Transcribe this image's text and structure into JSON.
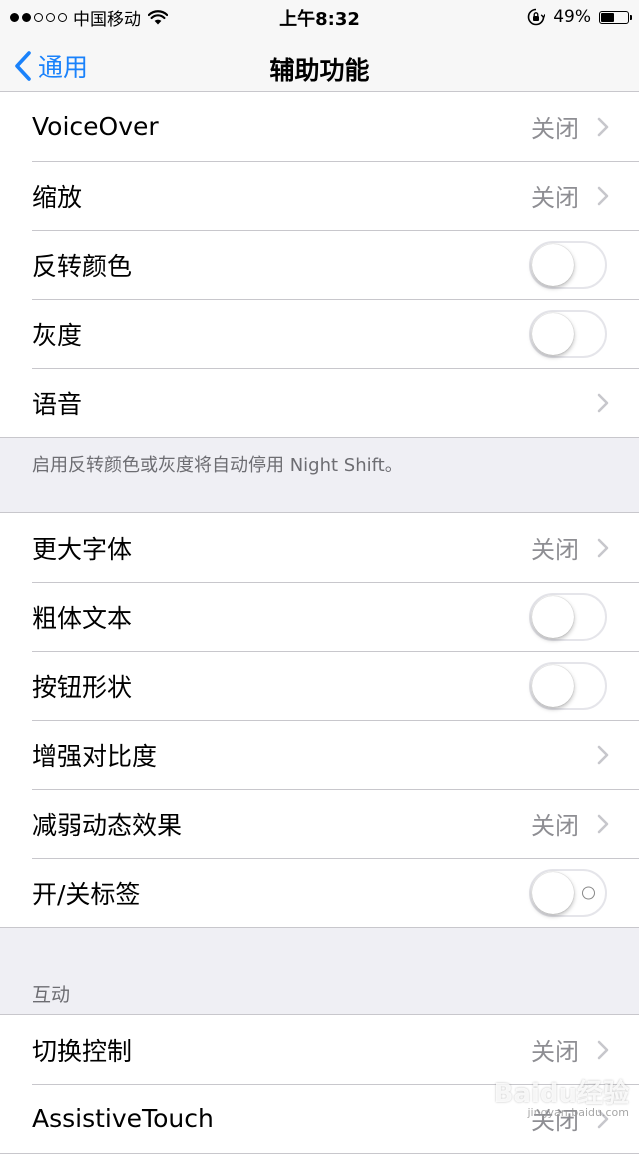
{
  "status_bar": {
    "signal_dots": [
      true,
      true,
      false,
      false,
      false
    ],
    "carrier": "中国移动",
    "time": "上午8:32",
    "battery_percent_text": "49%",
    "battery_level": 0.49
  },
  "nav": {
    "back_label": "通用",
    "title": "辅助功能"
  },
  "group1": {
    "rows": [
      {
        "label": "VoiceOver",
        "value": "关闭",
        "type": "link"
      },
      {
        "label": "缩放",
        "value": "关闭",
        "type": "link"
      },
      {
        "label": "反转颜色",
        "type": "toggle",
        "on": false
      },
      {
        "label": "灰度",
        "type": "toggle",
        "on": false
      },
      {
        "label": "语音",
        "type": "link"
      }
    ],
    "footer": "启用反转颜色或灰度将自动停用 Night Shift。"
  },
  "group2": {
    "rows": [
      {
        "label": "更大字体",
        "value": "关闭",
        "type": "link"
      },
      {
        "label": "粗体文本",
        "type": "toggle",
        "on": false
      },
      {
        "label": "按钮形状",
        "type": "toggle",
        "on": false
      },
      {
        "label": "增强对比度",
        "type": "link"
      },
      {
        "label": "减弱动态效果",
        "value": "关闭",
        "type": "link"
      },
      {
        "label": "开/关标签",
        "type": "toggle",
        "on": false
      }
    ]
  },
  "group3": {
    "header": "互动",
    "rows": [
      {
        "label": "切换控制",
        "value": "关闭",
        "type": "link"
      },
      {
        "label": "AssistiveTouch",
        "value": "关闭",
        "type": "link"
      }
    ]
  },
  "watermark": {
    "text": "Baidu经验",
    "subtext": "jingyan.baidu.com"
  },
  "colors": {
    "accent": "#1a82fb",
    "secondary_text": "#8e8e93",
    "background": "#efeff4"
  }
}
